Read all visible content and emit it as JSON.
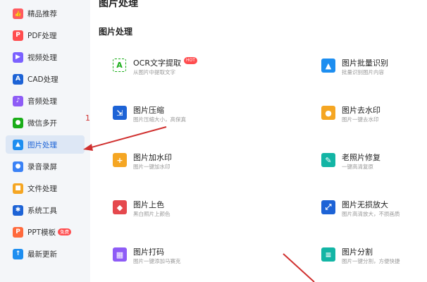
{
  "sidebar": {
    "items": [
      {
        "label": "精品推荐",
        "icon": "thumbs-up-icon",
        "color": "#ff5a5f"
      },
      {
        "label": "PDF处理",
        "icon": "pdf-icon",
        "color": "#ff4d4f"
      },
      {
        "label": "视频处理",
        "icon": "video-play-icon",
        "color": "#7b61ff"
      },
      {
        "label": "CAD处理",
        "icon": "cad-icon",
        "color": "#1d63d6"
      },
      {
        "label": "音频处理",
        "icon": "music-note-icon",
        "color": "#8e5cf6"
      },
      {
        "label": "微信多开",
        "icon": "wechat-icon",
        "color": "#1aad19"
      },
      {
        "label": "图片处理",
        "icon": "image-icon",
        "color": "#1d8ef0"
      },
      {
        "label": "录音录屏",
        "icon": "microphone-icon",
        "color": "#3b82f6"
      },
      {
        "label": "文件处理",
        "icon": "folder-icon",
        "color": "#f5a623"
      },
      {
        "label": "系统工具",
        "icon": "gear-icon",
        "color": "#1d63d6"
      },
      {
        "label": "PPT模板",
        "icon": "ppt-icon",
        "color": "#ff6a3d",
        "badge": "免费"
      },
      {
        "label": "最新更新",
        "icon": "upload-arrow-icon",
        "color": "#1d8ef0"
      }
    ],
    "active_index": 6
  },
  "header": {
    "title": "图片处理"
  },
  "section": {
    "title": "图片处理"
  },
  "tools": [
    {
      "name": "OCR文字提取",
      "desc": "从图片中提取文字",
      "icon": "ocr-icon",
      "color": "#1aad19",
      "hot": "HOT"
    },
    {
      "name": "图片批量识别",
      "desc": "批量识别图片内容",
      "icon": "image-batch-icon",
      "color": "#1d8ef0"
    },
    {
      "name": "图片压缩",
      "desc": "图片压缩大小，高保真",
      "icon": "compress-icon",
      "color": "#1d63d6"
    },
    {
      "name": "图片去水印",
      "desc": "图片一键去水印",
      "icon": "remove-watermark-icon",
      "color": "#f5a623"
    },
    {
      "name": "图片加水印",
      "desc": "图片一键加水印",
      "icon": "add-watermark-icon",
      "color": "#f5a623"
    },
    {
      "name": "老照片修复",
      "desc": "一键高清复原",
      "icon": "repair-icon",
      "color": "#13b5a5"
    },
    {
      "name": "图片上色",
      "desc": "黑白照片上颜色",
      "icon": "paint-bucket-icon",
      "color": "#e5484d"
    },
    {
      "name": "图片无损放大",
      "desc": "图片高清放大，不损画质",
      "icon": "enlarge-icon",
      "color": "#1d63d6"
    },
    {
      "name": "图片打码",
      "desc": "图片一键添加马赛克",
      "icon": "mosaic-icon",
      "color": "#8e5cf6"
    },
    {
      "name": "图片分割",
      "desc": "图片一键分割，方便快捷",
      "icon": "split-icon",
      "color": "#13b5a5"
    }
  ],
  "annotation": {
    "number": "1",
    "color": "#d0302f"
  }
}
